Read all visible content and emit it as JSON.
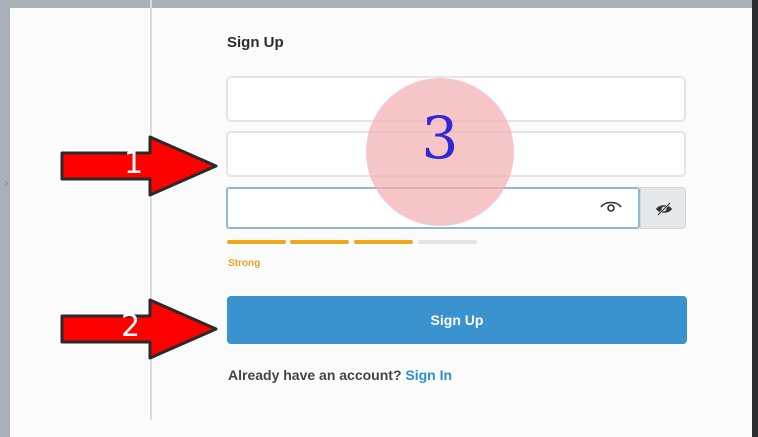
{
  "form": {
    "title": "Sign Up",
    "fields": [
      {
        "value": "",
        "placeholder": ""
      },
      {
        "value": "",
        "placeholder": ""
      }
    ],
    "password": {
      "value": "",
      "placeholder": ""
    },
    "strength": {
      "label": "Strong",
      "filled_segments": 3,
      "total_segments": 4,
      "color": "#f2a81d"
    },
    "submit_label": "Sign Up",
    "account_text": "Already have an account?",
    "signin_label": "Sign In"
  },
  "annotations": {
    "arrow1_label": "1",
    "arrow2_label": "2",
    "circle_label": "3",
    "arrow_color": "#ff0000",
    "circle_color": "#f4b0b0"
  },
  "colors": {
    "primary": "#3a93cf",
    "link": "#2e8fd0",
    "strength": "#f2a81d"
  },
  "icons": {
    "side": "caret-right-icon",
    "eye": "eye-icon",
    "eye_slash": "eye-slash-icon"
  }
}
